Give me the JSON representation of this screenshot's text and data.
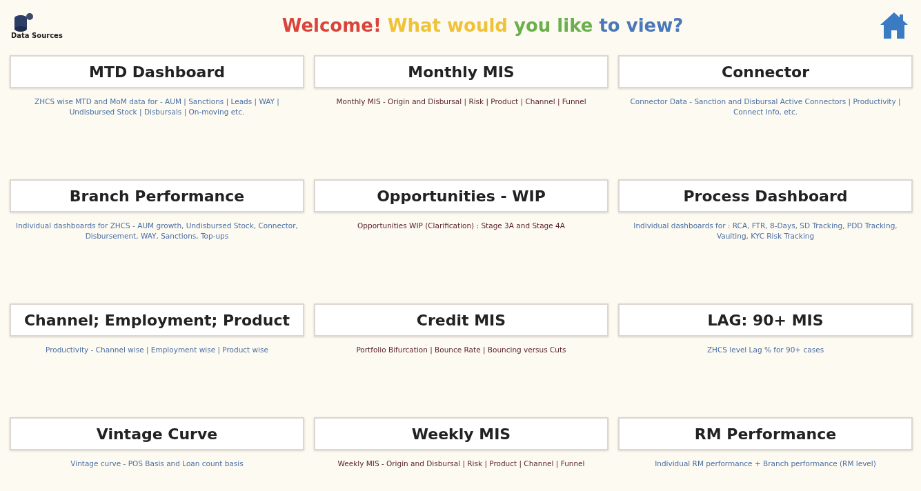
{
  "logo": {
    "label": "Data Sources"
  },
  "title": [
    {
      "text": "Welcome!",
      "color": "#d9453d"
    },
    {
      "text": "What would",
      "color": "#f0c23a"
    },
    {
      "text": "you like",
      "color": "#6ab04c"
    },
    {
      "text": "to view?",
      "color": "#4a78b8"
    }
  ],
  "tiles": [
    {
      "title": "MTD Dashboard",
      "description": "ZHCS wise MTD and MoM data for - AUM | Sanctions | Leads | WAY | Undisbursed Stock | Disbursals | On-moving etc.",
      "color": "#4a6fa5"
    },
    {
      "title": "Monthly MIS",
      "description": "Monthly MIS - Origin and Disbursal | Risk | Product | Channel | Funnel",
      "color": "#5a2430"
    },
    {
      "title": "Connector",
      "description": "Connector Data - Sanction and Disbursal Active Connectors | Productivity | Connect Info, etc.",
      "color": "#4a6fa5"
    },
    {
      "title": "Branch Performance",
      "description": "Individual dashboards for ZHCS - AUM growth, Undisbursed Stock, Connector, Disbursement, WAY, Sanctions, Top-ups",
      "color": "#4a6fa5"
    },
    {
      "title": "Opportunities - WIP",
      "description": "Opportunities WIP (Clarification) : Stage 3A and Stage 4A",
      "color": "#5a2430"
    },
    {
      "title": "Process Dashboard",
      "description": "Individual dashboards for : RCA, FTR, 8-Days, SD Tracking, PDD Tracking, Vaulting, KYC Risk Tracking",
      "color": "#4a6fa5"
    },
    {
      "title": "Channel; Employment; Product",
      "description": "Productivity - Channel wise | Employment wise | Product wise",
      "color": "#4a6fa5"
    },
    {
      "title": "Credit MIS",
      "description": "Portfolio Bifurcation | Bounce Rate | Bouncing versus Cuts",
      "color": "#5a2430"
    },
    {
      "title": "LAG: 90+ MIS",
      "description": "ZHCS level Lag % for 90+ cases",
      "color": "#4a6fa5"
    },
    {
      "title": "Vintage Curve",
      "description": "Vintage curve - POS Basis and Loan count basis",
      "color": "#4a6fa5"
    },
    {
      "title": "Weekly MIS",
      "description": "Weekly MIS - Origin and Disbursal | Risk | Product | Channel | Funnel",
      "color": "#5a2430"
    },
    {
      "title": "RM Performance",
      "description": "Individual RM performance + Branch performance (RM level)",
      "color": "#4a6fa5"
    }
  ]
}
